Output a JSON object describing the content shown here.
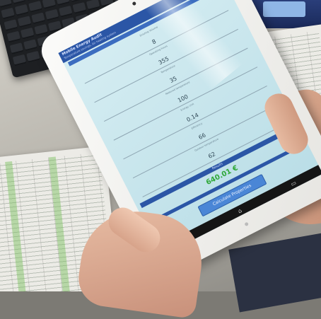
{
  "app": {
    "title": "Mobile Energy Audit",
    "subtitle": "Temperature savings, Air heating system"
  },
  "fields": [
    {
      "label": "Existing Volume",
      "value": "8"
    },
    {
      "label": "Operating hours",
      "value": "355"
    },
    {
      "label": "Temperature",
      "value": "35"
    },
    {
      "label": "Reduced temperature",
      "value": "100"
    },
    {
      "label": "Energy cost",
      "value": "0.14"
    },
    {
      "label": "Efficiency",
      "value": "66"
    },
    {
      "label": "Outdoor temperature",
      "value": "62"
    }
  ],
  "results": {
    "bar_label": "Results",
    "value": "640.01 €"
  },
  "button": {
    "calculate_label": "Calculate Properties"
  },
  "navbar": {
    "back": "↶",
    "home": "⌂",
    "recent": "▭"
  }
}
